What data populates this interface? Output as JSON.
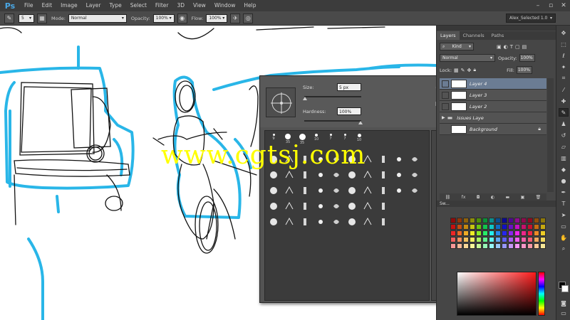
{
  "app": {
    "logo": "Ps"
  },
  "menu": [
    "File",
    "Edit",
    "Image",
    "Layer",
    "Type",
    "Select",
    "Filter",
    "3D",
    "View",
    "Window",
    "Help"
  ],
  "options_bar": {
    "brush_size": "5",
    "mode_label": "Mode:",
    "mode_value": "Normal",
    "opacity_label": "Opacity:",
    "opacity_value": "100%",
    "flow_label": "Flow:",
    "flow_value": "100%",
    "workspace": "Alex_Selected 1.0"
  },
  "brush_picker": {
    "size_label": "Size:",
    "size_value": "5 px",
    "hardness_label": "Hardness:",
    "hardness_value": "100%",
    "brushes": [
      {
        "num": "9",
        "d": 3
      },
      {
        "num": "35",
        "d": 8
      },
      {
        "num": "35",
        "d": 9
      },
      {
        "num": "10",
        "d": 4
      },
      {
        "num": "7",
        "d": 3
      },
      {
        "num": "7",
        "d": 3
      },
      {
        "num": "10",
        "d": 5
      }
    ]
  },
  "panels": {
    "tabs": [
      "Layers",
      "Channels",
      "Paths"
    ],
    "kind_label": "Kind",
    "blend_mode": "Normal",
    "opacity_label": "Opacity:",
    "opacity_value": "100%",
    "lock_label": "Lock:",
    "fill_label": "Fill:",
    "fill_value": "100%",
    "layers": [
      {
        "name": "Layer 4",
        "selected": true
      },
      {
        "name": "Layer 3",
        "selected": false
      },
      {
        "name": "Layer 2",
        "selected": false
      },
      {
        "name": "Issues Laye",
        "selected": false
      },
      {
        "name": "Background",
        "selected": false
      }
    ],
    "swatches_tab": "Sw..."
  },
  "watermark": "www.cgtsj.com",
  "colors": {
    "sketch_blue": "#29b6e8",
    "selected_layer": "#6b7c93"
  }
}
